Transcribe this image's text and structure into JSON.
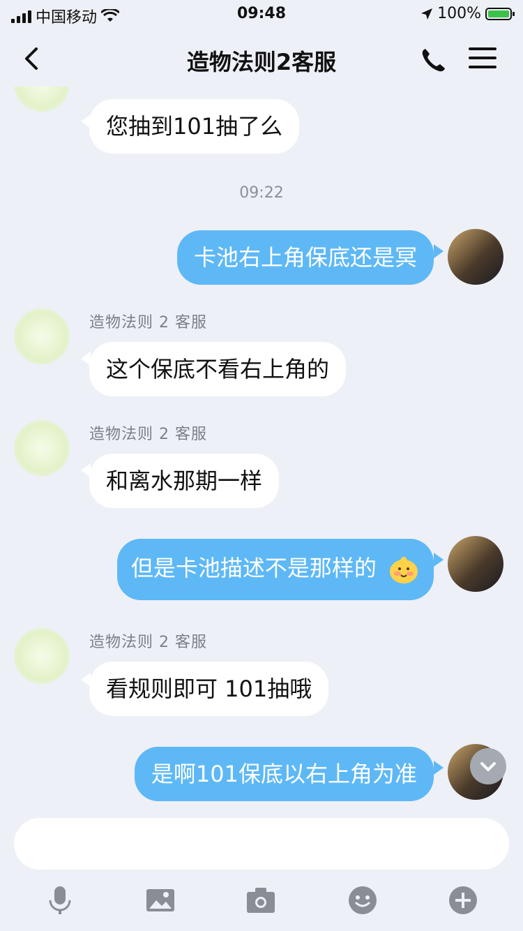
{
  "status": {
    "carrier": "中国移动",
    "time": "09:48",
    "battery": "100%"
  },
  "header": {
    "title": "造物法则2客服"
  },
  "messages": [
    {
      "side": "in",
      "text": "您抽到101抽了么"
    },
    {
      "type": "time",
      "text": "09:22"
    },
    {
      "side": "out",
      "text": "卡池右上角保底还是冥"
    },
    {
      "side": "in",
      "sender": "造物法则 2 客服",
      "text": "这个保底不看右上角的"
    },
    {
      "side": "in",
      "sender": "造物法则 2 客服",
      "text": "和离水那期一样"
    },
    {
      "side": "out",
      "text": "但是卡池描述不是那样的",
      "emoji": "smiling-blush-emoji"
    },
    {
      "side": "in",
      "sender": "造物法则 2 客服",
      "text": "看规则即可  101抽哦"
    },
    {
      "side": "out",
      "text": "是啊101保底以右上角为准"
    }
  ],
  "input": {
    "value": ""
  },
  "toolbar": [
    "microphone-icon",
    "image-icon",
    "camera-icon",
    "emoji-icon",
    "plus-icon"
  ],
  "colors": {
    "background": "#eef0f7",
    "out_bubble": "#5eb8f6",
    "in_bubble": "#ffffff"
  }
}
